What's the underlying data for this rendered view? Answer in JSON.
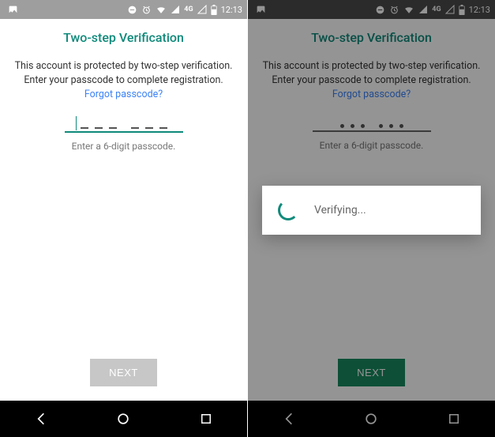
{
  "status": {
    "network": "4G",
    "time": "12:13"
  },
  "screen": {
    "title": "Two-step Verification",
    "desc_prefix": "This account is protected by two-step verification. Enter your passcode to complete registration. ",
    "forgot_link": "Forgot passcode?",
    "hint": "Enter a 6-digit passcode.",
    "next_label": "NEXT"
  },
  "dialog": {
    "text": "Verifying..."
  }
}
